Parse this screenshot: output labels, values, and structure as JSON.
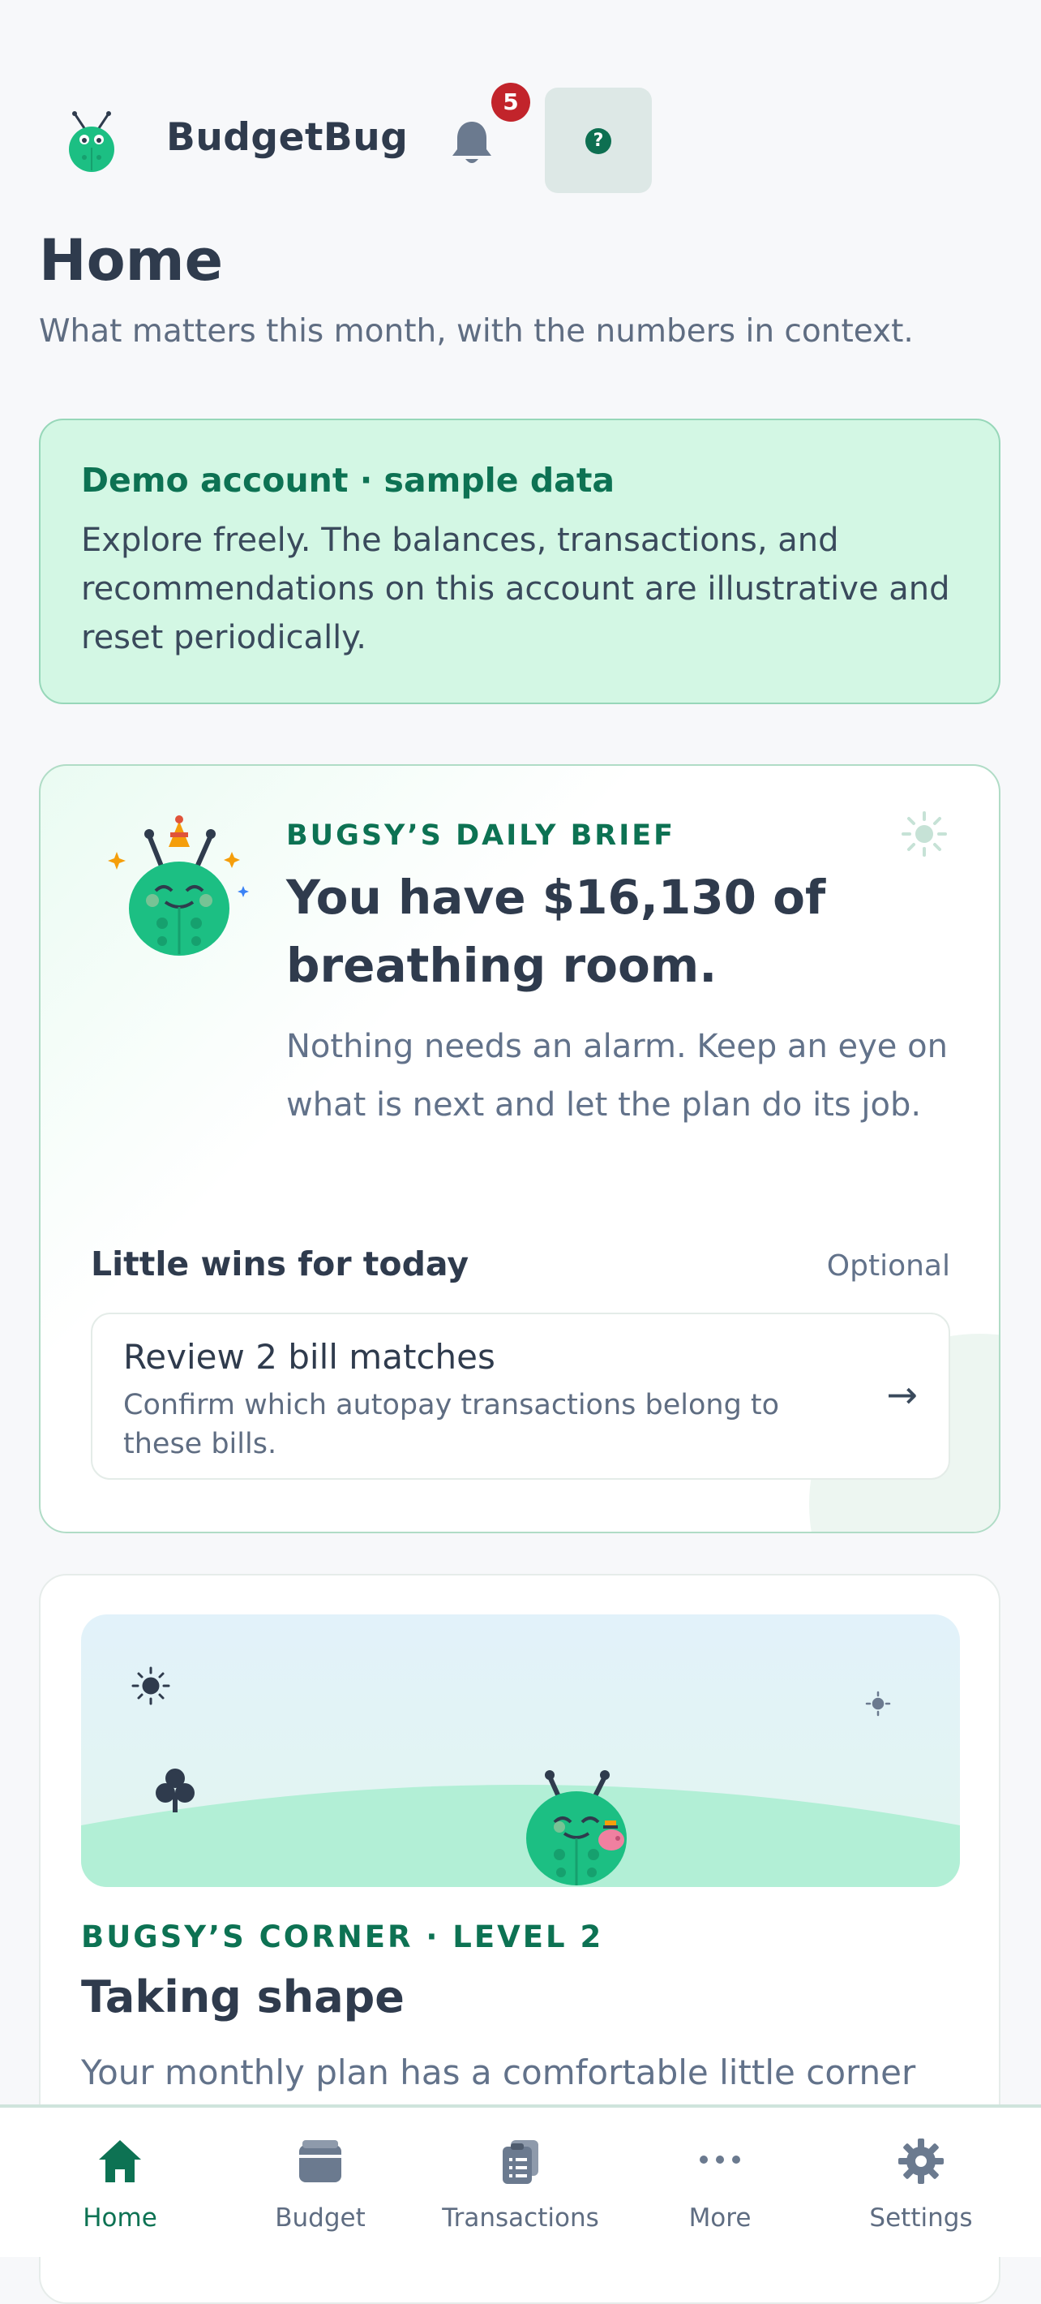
{
  "header": {
    "app_name": "BudgetBug",
    "notifications_count": "5",
    "help_label": "?"
  },
  "page": {
    "title": "Home",
    "subtitle": "What matters this month, with the numbers in context."
  },
  "demo_banner": {
    "title": "Demo account · sample data",
    "body": "Explore freely. The balances, transactions, and recommendations on this account are illustrative and reset periodically."
  },
  "brief": {
    "kicker": "BUGSY’S DAILY BRIEF",
    "headline": "You have $16,130 of breathing room.",
    "body": "Nothing needs an alarm. Keep an eye on what is next and let the plan do its job.",
    "wins_title": "Little wins for today",
    "wins_optional": "Optional",
    "wins": [
      {
        "title": "Review 2 bill matches",
        "description": "Confirm which autopay transactions belong to these bills.",
        "arrow": "→"
      }
    ]
  },
  "corner": {
    "kicker": "BUGSY’S CORNER · LEVEL 2",
    "title": "Taking shape",
    "body": "Your monthly plan has a comfortable little corner"
  },
  "nav": {
    "items": [
      {
        "label": "Home",
        "icon": "home-icon"
      },
      {
        "label": "Budget",
        "icon": "wallet-icon"
      },
      {
        "label": "Transactions",
        "icon": "clipboard-icon"
      },
      {
        "label": "More",
        "icon": "more-dots-icon"
      },
      {
        "label": "Settings",
        "icon": "gear-icon"
      }
    ],
    "active": "Home"
  },
  "colors": {
    "brand_green": "#0d7253",
    "bug_green": "#1cbf83",
    "badge_red": "#c2242b",
    "text_dark": "#2f3b4d",
    "text_muted": "#62728a"
  }
}
